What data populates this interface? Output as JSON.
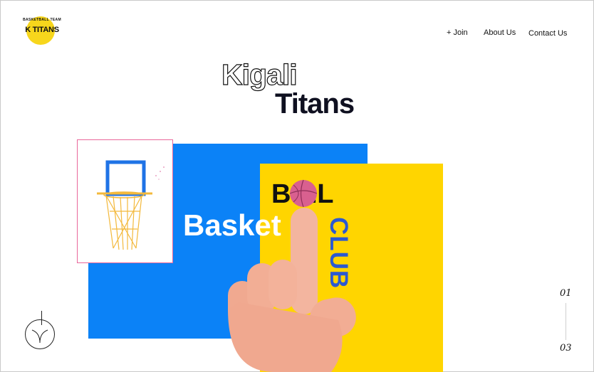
{
  "header": {
    "logo": {
      "top_text": "BASKETBALL TEAM",
      "main_text": "K TITANS"
    },
    "nav": [
      {
        "label": "+ Join"
      },
      {
        "label": "About Us"
      },
      {
        "label": "Contact Us"
      }
    ]
  },
  "hero": {
    "title_line1": "Kigali",
    "title_line2": "Titans",
    "word_basket": "Basket",
    "word_ball": "B  LL",
    "word_club": "CLUB"
  },
  "pagination": {
    "current": "01",
    "total": "03"
  },
  "colors": {
    "blue_panel": "#0b82f7",
    "yellow_panel": "#ffd500",
    "club_text": "#2b59d1",
    "card_border": "#e9679b"
  }
}
